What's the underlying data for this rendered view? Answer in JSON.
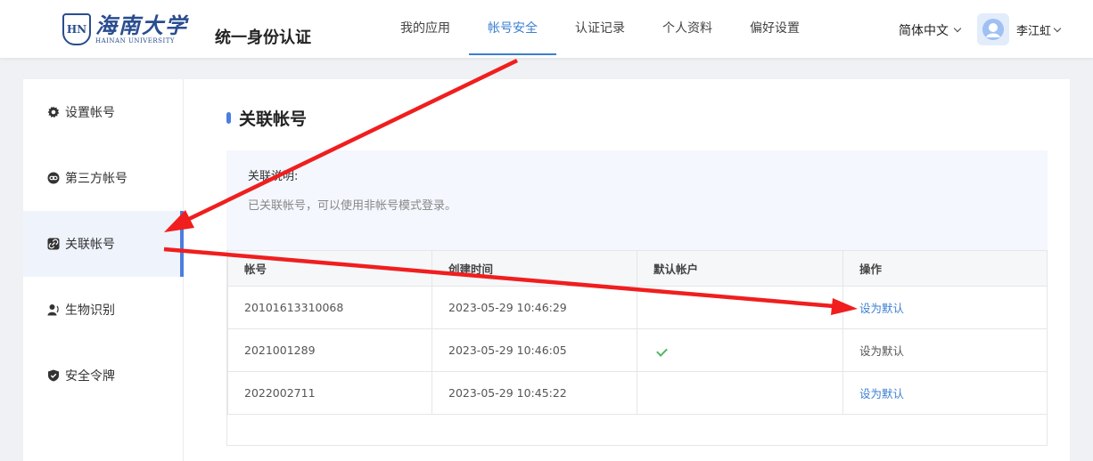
{
  "header": {
    "logo": {
      "emblem": "HN",
      "cn": "海南大学",
      "en": "HAINAN UNIVERSITY"
    },
    "site_title": "统一身份认证",
    "nav": [
      {
        "label": "我的应用",
        "active": false
      },
      {
        "label": "帐号安全",
        "active": true
      },
      {
        "label": "认证记录",
        "active": false
      },
      {
        "label": "个人资料",
        "active": false
      },
      {
        "label": "偏好设置",
        "active": false
      }
    ],
    "language": "简体中文",
    "user_name": "李江虹"
  },
  "sidebar": {
    "items": [
      {
        "label": "设置帐号",
        "icon": "gear-icon",
        "active": false
      },
      {
        "label": "第三方帐号",
        "icon": "link-circle-icon",
        "active": false
      },
      {
        "label": "关联帐号",
        "icon": "linked-account-icon",
        "active": true
      },
      {
        "label": "生物识别",
        "icon": "user-biometric-icon",
        "active": false
      },
      {
        "label": "安全令牌",
        "icon": "shield-check-icon",
        "active": false
      }
    ]
  },
  "main": {
    "section_title": "关联帐号",
    "note": {
      "title": "关联说明:",
      "body": "已关联帐号，可以使用非帐号模式登录。"
    },
    "table": {
      "headers": [
        "帐号",
        "创建时间",
        "默认帐户",
        "操作"
      ],
      "rows": [
        {
          "account": "20101613310068",
          "created": "2023-05-29 10:46:29",
          "is_default": false,
          "action": "设为默认",
          "action_enabled": true
        },
        {
          "account": "2021001289",
          "created": "2023-05-29 10:46:05",
          "is_default": true,
          "action": "设为默认",
          "action_enabled": false
        },
        {
          "account": "2022002711",
          "created": "2023-05-29 10:45:22",
          "is_default": false,
          "action": "设为默认",
          "action_enabled": true
        }
      ]
    }
  },
  "colors": {
    "accent": "#3c7fd1",
    "annotation_arrow": "#f01e1e",
    "check": "#52b766"
  }
}
